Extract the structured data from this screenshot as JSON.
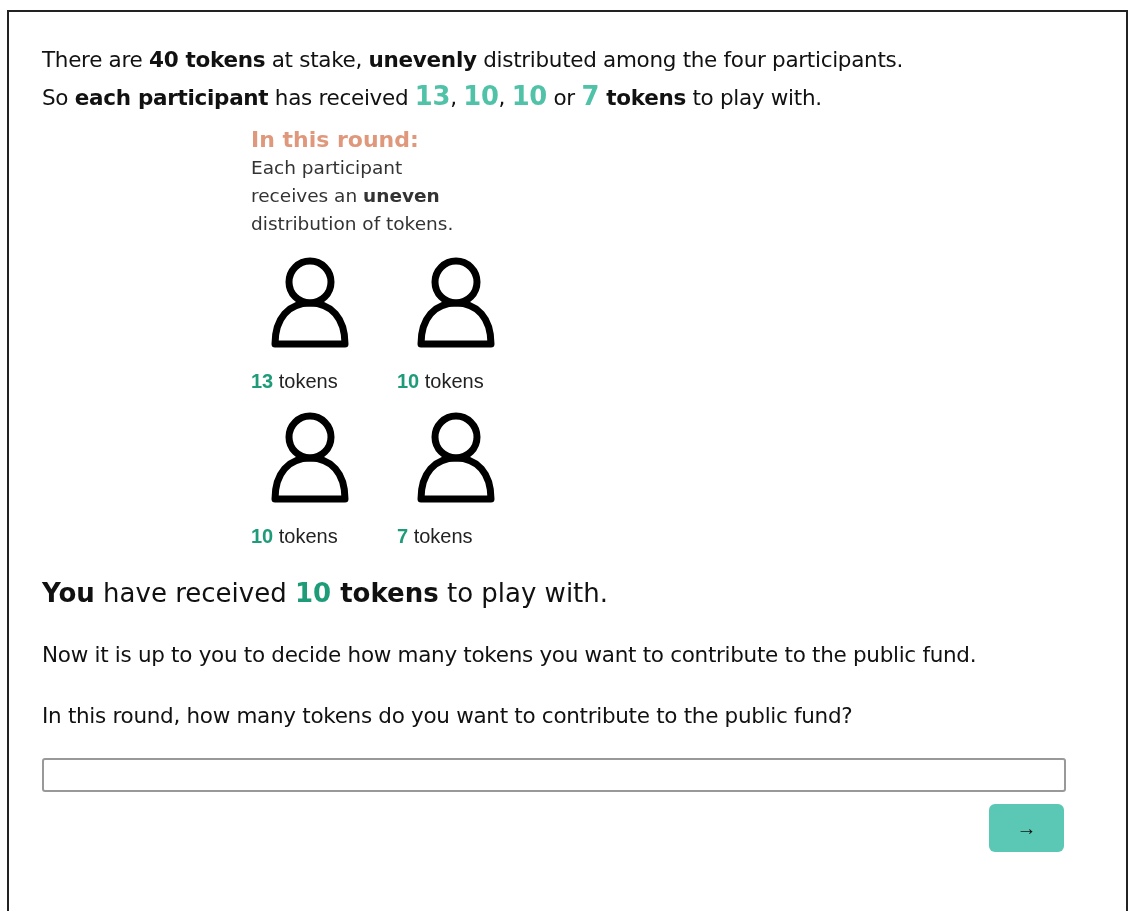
{
  "intro": [
    [
      {
        "kind": "plain",
        "text": "There are "
      },
      {
        "kind": "bold",
        "text": "40 tokens"
      },
      {
        "kind": "plain",
        "text": " at stake, "
      },
      {
        "kind": "bold",
        "text": "unevenly"
      },
      {
        "kind": "plain",
        "text": " distributed among the four participants."
      }
    ],
    [
      {
        "kind": "plain",
        "text": "So "
      },
      {
        "kind": "bold",
        "text": "each participant"
      },
      {
        "kind": "plain",
        "text": " has received "
      },
      {
        "kind": "accent",
        "text": "13"
      },
      {
        "kind": "plain",
        "text": ", "
      },
      {
        "kind": "accent",
        "text": "10"
      },
      {
        "kind": "plain",
        "text": ", "
      },
      {
        "kind": "accent",
        "text": "10"
      },
      {
        "kind": "plain",
        "text": " or "
      },
      {
        "kind": "accent",
        "text": "7"
      },
      {
        "kind": "bold",
        "text": " tokens"
      },
      {
        "kind": "plain",
        "text": " to play with."
      }
    ]
  ],
  "infographic": {
    "heading": "In this round:",
    "description": [
      "Each participant",
      "receives an **uneven**",
      "distribution of tokens."
    ],
    "participants": [
      {
        "count": "13",
        "unit": "tokens"
      },
      {
        "count": "10",
        "unit": "tokens"
      },
      {
        "count": "10",
        "unit": "tokens"
      },
      {
        "count": "7",
        "unit": "tokens"
      }
    ]
  },
  "received": [
    {
      "kind": "bold",
      "text": "You"
    },
    {
      "kind": "plain",
      "text": " have received "
    },
    {
      "kind": "accent",
      "text": "10"
    },
    {
      "kind": "bold",
      "text": " tokens"
    },
    {
      "kind": "plain",
      "text": " to play with."
    }
  ],
  "instruction": "Now it is up to you to decide how many tokens you want to contribute to the public fund.",
  "question": "In this round, how many tokens do you want to contribute to the public fund?",
  "next_button": "→"
}
